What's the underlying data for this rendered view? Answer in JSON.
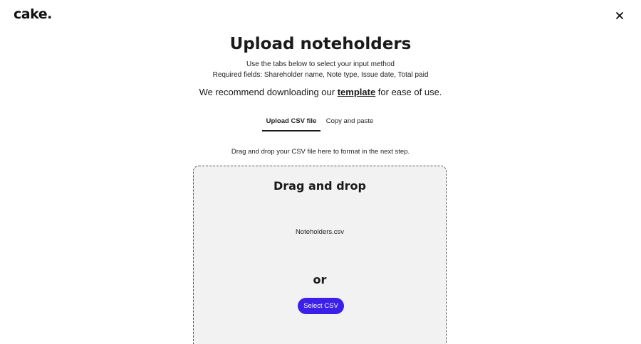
{
  "header": {
    "logo_text": "cake.",
    "close_icon": "close-icon"
  },
  "title": "Upload noteholders",
  "instructions": {
    "line1": "Use the tabs below to select your input method",
    "line2": "Required fields: Shareholder name, Note type, Issue date, Total paid"
  },
  "recommend": {
    "before": "We recommend downloading our ",
    "link": "template",
    "after": " for ease of use."
  },
  "tabs": [
    {
      "label": "Upload CSV file",
      "active": true
    },
    {
      "label": "Copy and paste",
      "active": false
    }
  ],
  "hint": "Drag and drop your CSV file here to format in the next step.",
  "dropzone": {
    "title": "Drag and drop",
    "file_name": "Noteholders.csv",
    "or_text": "or",
    "button_label": "Select CSV"
  },
  "colors": {
    "accent": "#3c1fe8",
    "dropzone_bg": "#f2f2f2"
  }
}
